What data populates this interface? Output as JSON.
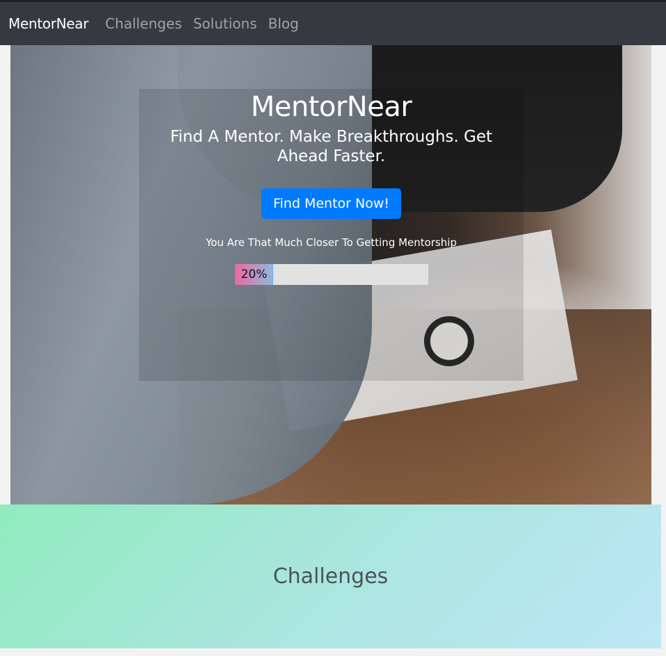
{
  "navbar": {
    "brand": "MentorNear",
    "links": [
      "Challenges",
      "Solutions",
      "Blog"
    ]
  },
  "hero": {
    "title": "MentorNear",
    "subtitle": "Find A Mentor. Make Breakthroughs. Get Ahead Faster.",
    "cta_label": "Find Mentor Now!",
    "closer_text": "You Are That Much Closer To Getting Mentorship",
    "progress": {
      "percent": 20,
      "label": "20%"
    }
  },
  "challenges": {
    "heading": "Challenges"
  },
  "colors": {
    "navbar_bg": "#343a40",
    "cta_bg": "#007bff",
    "gradient_start": "#8fecbd",
    "gradient_end": "#bde7f6"
  }
}
